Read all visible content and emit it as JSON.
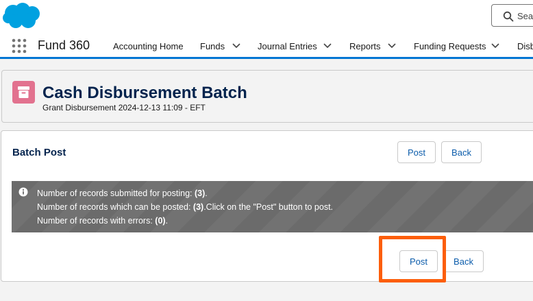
{
  "header": {
    "search_placeholder": "Sear"
  },
  "nav": {
    "app_name": "Fund 360",
    "items": [
      {
        "label": "Accounting Home"
      },
      {
        "label": "Funds"
      },
      {
        "label": "Journal Entries"
      },
      {
        "label": "Reports"
      },
      {
        "label": "Funding Requests"
      },
      {
        "label": "Disb"
      }
    ]
  },
  "page_header": {
    "title": "Cash Disbursement Batch",
    "subtitle": "Grant Disbursement 2024-12-13 11:09 - EFT"
  },
  "card": {
    "title": "Batch Post",
    "post_label": "Post",
    "back_label": "Back",
    "info": {
      "line1_text": "Number of records submitted for posting: ",
      "line1_value": "(3)",
      "line1_suffix": ".",
      "line2_text": "Number of records which can be posted: ",
      "line2_value": "(3)",
      "line2_suffix": ".Click on the \"Post\" button to post.",
      "line3_text": "Number of records with errors: ",
      "line3_value": "(0)",
      "line3_suffix": "."
    }
  },
  "colors": {
    "brand_blue": "#0176d3",
    "title_navy": "#03234d",
    "object_icon": "#e2728f",
    "highlight_orange": "#fc5e0a"
  }
}
